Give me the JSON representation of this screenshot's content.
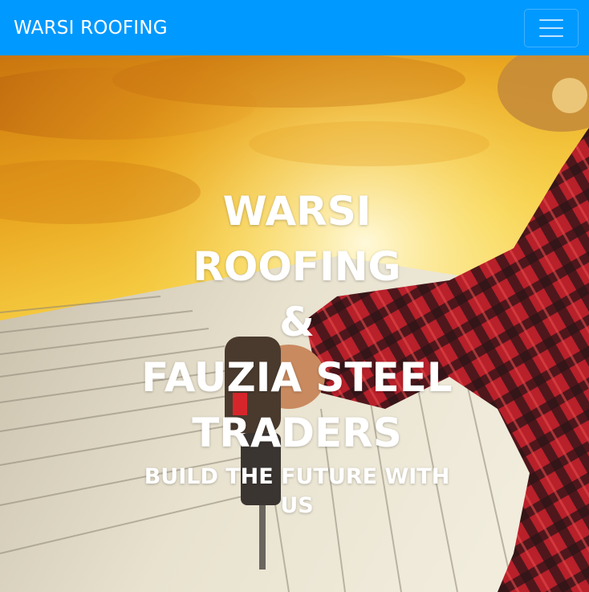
{
  "navbar": {
    "brand": "WARSI ROOFING",
    "toggle_icon": "hamburger-menu-icon",
    "background_color": "#0099ff"
  },
  "hero": {
    "title_lines": [
      "WARSI",
      "ROOFING",
      "&",
      "FAUZIA STEEL",
      "TRADERS"
    ],
    "subtitle": "BUILD THE FUTURE WITH US",
    "image_description_icon": "roofing-worker-photo"
  }
}
